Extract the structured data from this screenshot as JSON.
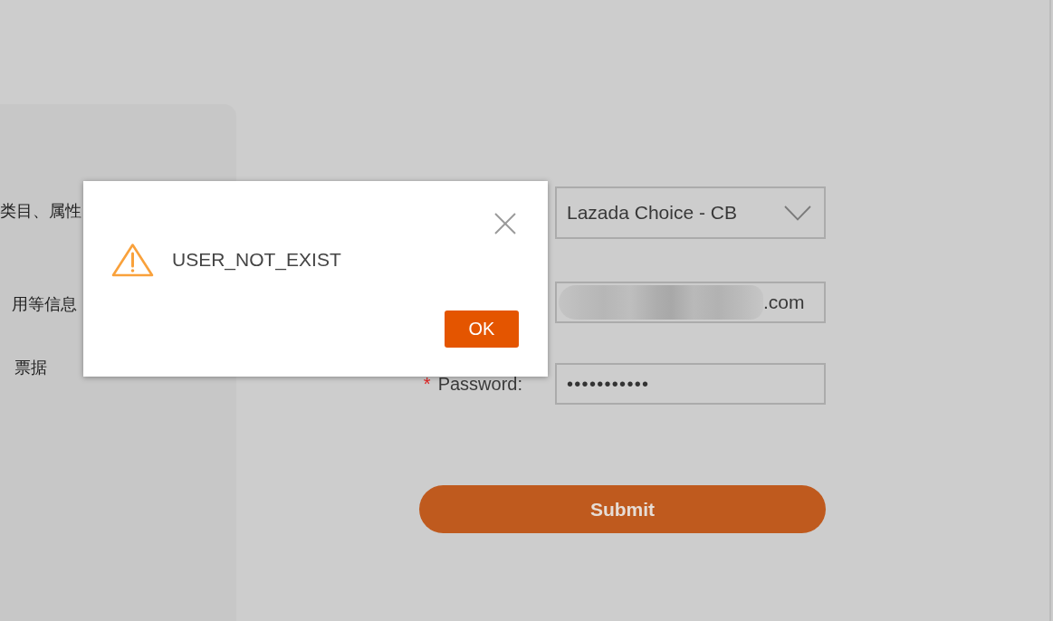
{
  "side_panel": {
    "lines": [
      "类目、属性",
      "用等信息",
      "票据"
    ]
  },
  "login_form": {
    "store_select": {
      "value": "Lazada Choice - CB"
    },
    "email_field": {
      "value": ".com",
      "redacted": true
    },
    "password_field": {
      "required_mark": "*",
      "label": "Password:",
      "value": "•••••••••••"
    },
    "submit_button": "Submit"
  },
  "dialog": {
    "kind": "warning",
    "message": "USER_NOT_EXIST",
    "buttons": [
      "OK"
    ]
  }
}
